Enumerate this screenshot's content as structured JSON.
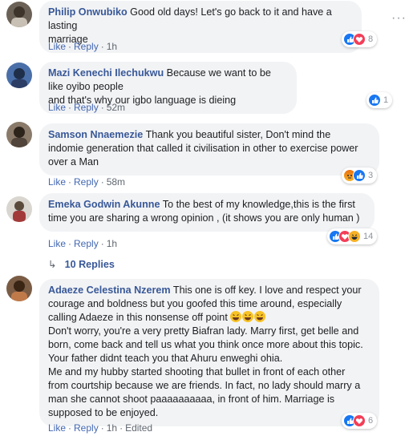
{
  "actions": {
    "like": "Like",
    "reply": "Reply",
    "separator": "·",
    "edited": "Edited"
  },
  "comments": [
    {
      "author": "Philip Onwubiko",
      "lines": [
        "Good old days! Let's go back to it and have a lasting",
        "marriage"
      ],
      "time": "1h",
      "reaction_count": "8",
      "reactions": [
        "like-icon",
        "love-icon"
      ]
    },
    {
      "author": "Mazi Kenechi Ilechukwu",
      "lines": [
        "Because we want to be like oyibo people",
        "and that's why our igbo language is dieing"
      ],
      "time": "52m",
      "reaction_count": "1",
      "reactions": [
        "like-icon"
      ]
    },
    {
      "author": "Samson Nnaemezie",
      "lines": [
        "Thank you beautiful sister, Don't mind the",
        "indomie generation that called it civilisation in other to exercise power",
        "over a Man"
      ],
      "time": "58m",
      "reaction_count": "3",
      "reactions": [
        "angry-icon",
        "like-icon"
      ]
    },
    {
      "author": "Emeka Godwin Akunne",
      "lines": [
        "To the best of my knowledge,this is the first",
        "time you are sharing a wrong opinion , (it shows you are only human )"
      ],
      "time": "1h",
      "reaction_count": "14",
      "reactions": [
        "like-icon",
        "love-icon",
        "haha-icon"
      ]
    },
    {
      "author": "Adaeze Celestina Nzerem",
      "lines": [
        "This one is off key. I love and respect your",
        "courage and boldness but you goofed this time around, especially",
        "calling Adaeze in this nonsense off point",
        "Don't worry, you're a very pretty Biafran lady. Marry first, get belle and",
        "born, come back and tell us what you think once more about this topic.",
        "Your father didnt teach you that Ahuru enweghi ohia.",
        "Me and my hubby started shooting that bullet in front of each other",
        "from courtship because we are friends. In fact, no lady should marry a",
        "man she cannot shoot paaaaaaaaaa, in front of him. Marriage is",
        "supposed to be enjoyed."
      ],
      "time": "1h",
      "reaction_count": "6",
      "reactions": [
        "like-icon",
        "love-icon"
      ]
    }
  ],
  "replies_label": "10 Replies"
}
